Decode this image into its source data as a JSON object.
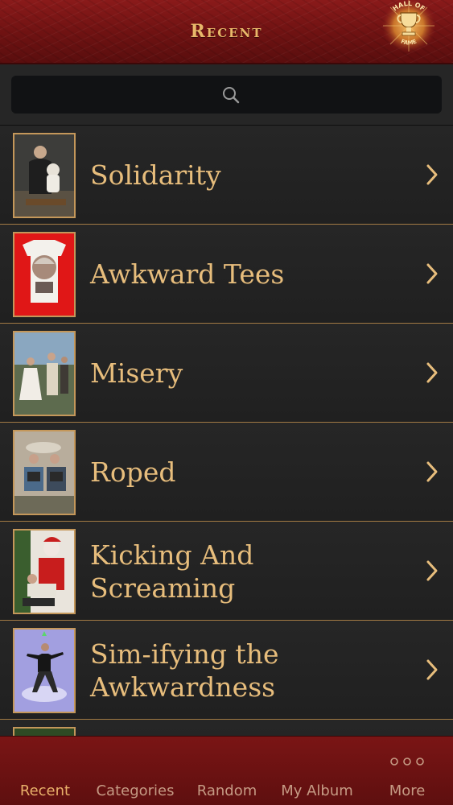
{
  "header": {
    "title": "Recent",
    "badge": {
      "top": "HALL OF",
      "bottom": "FAME"
    }
  },
  "search": {
    "placeholder": ""
  },
  "colors": {
    "accent": "#e7bd7c",
    "divider": "#a27a44",
    "bar": "#6e1212"
  },
  "list": {
    "items": [
      {
        "label": "Solidarity"
      },
      {
        "label": "Awkward Tees"
      },
      {
        "label": "Misery"
      },
      {
        "label": "Roped"
      },
      {
        "label": "Kicking And Screaming"
      },
      {
        "label": "Sim-ifying the Awkwardness"
      }
    ]
  },
  "tabbar": {
    "tabs": [
      {
        "label": "Recent"
      },
      {
        "label": "Categories"
      },
      {
        "label": "Random"
      },
      {
        "label": "My Album"
      },
      {
        "label": "More"
      }
    ],
    "active": "Recent"
  }
}
